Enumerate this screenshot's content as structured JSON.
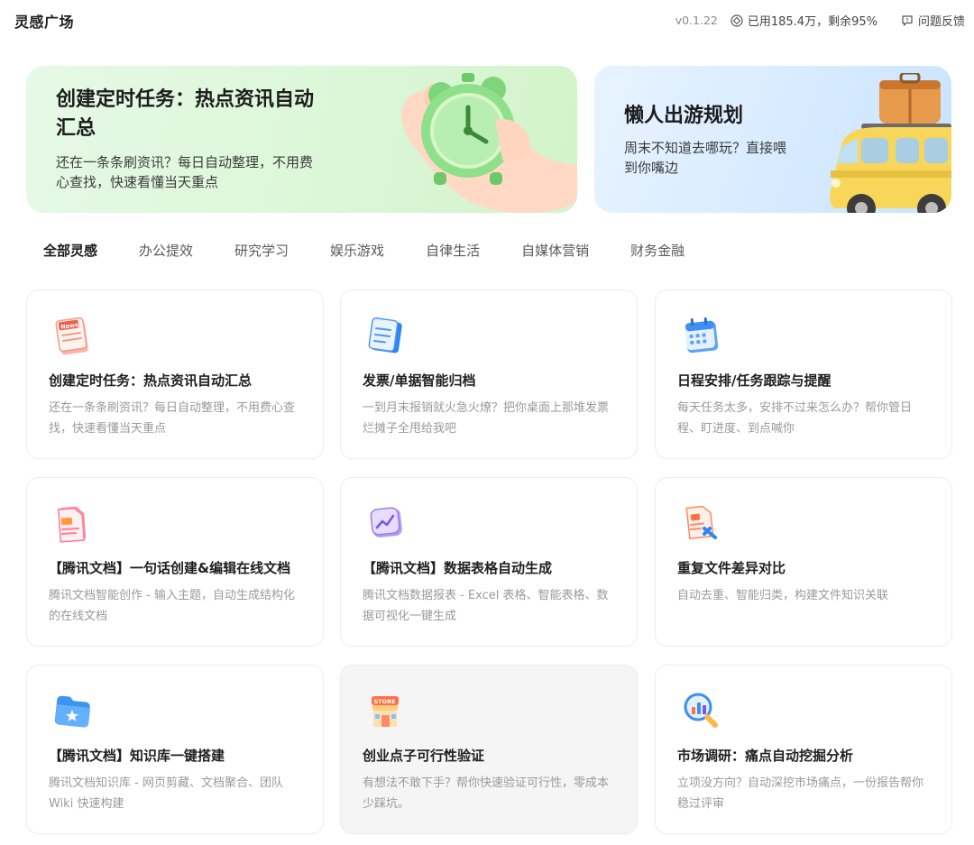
{
  "header": {
    "title": "灵感广场",
    "version": "v0.1.22",
    "quota": "已用185.4万，剩余95%",
    "feedback": "问题反馈"
  },
  "banners": [
    {
      "title": "创建定时任务：热点资讯自动汇总",
      "desc": "还在一条条刷资讯？每日自动整理，不用费心查找，快速看懂当天重点"
    },
    {
      "title": "懒人出游规划",
      "desc": "周末不知道去哪玩？直接喂到你嘴边"
    }
  ],
  "tabs": [
    "全部灵感",
    "办公提效",
    "研究学习",
    "娱乐游戏",
    "自律生活",
    "自媒体营销",
    "财务金融"
  ],
  "cards": [
    {
      "icon": "news-icon",
      "title": "创建定时任务：热点资讯自动汇总",
      "desc": "还在一条条刷资讯？每日自动整理，不用费心查找，快速看懂当天重点"
    },
    {
      "icon": "invoice-icon",
      "title": "发票/单据智能归档",
      "desc": "一到月末报销就火急火燎？把你桌面上那堆发票烂摊子全甩给我吧"
    },
    {
      "icon": "calendar-icon",
      "title": "日程安排/任务跟踪与提醒",
      "desc": "每天任务太多，安排不过来怎么办？帮你管日程、盯进度、到点喊你"
    },
    {
      "icon": "document-icon",
      "title": "【腾讯文档】一句话创建&编辑在线文档",
      "desc": "腾讯文档智能创作 - 输入主题，自动生成结构化的在线文档"
    },
    {
      "icon": "chart-window-icon",
      "title": "【腾讯文档】数据表格自动生成",
      "desc": "腾讯文档数据报表 - Excel 表格、智能表格、数据可视化一键生成"
    },
    {
      "icon": "compare-file-icon",
      "title": "重复文件差异对比",
      "desc": "自动去重、智能归类，构建文件知识关联"
    },
    {
      "icon": "folder-star-icon",
      "title": "【腾讯文档】知识库一键搭建",
      "desc": "腾讯文档知识库 - 网页剪藏、文档聚合、团队 Wiki 快速构建"
    },
    {
      "icon": "store-icon",
      "title": "创业点子可行性验证",
      "desc": "有想法不敢下手？帮你快速验证可行性，零成本少踩坑。"
    },
    {
      "icon": "magnifier-chart-icon",
      "title": "市场调研：痛点自动挖掘分析",
      "desc": "立项没方向？自动深挖市场痛点，一份报告帮你稳过评审"
    }
  ],
  "icon_labels": {
    "news": "News",
    "store": "STORE"
  },
  "colors": {
    "banner_green": "#dcf7d8",
    "banner_blue": "#d7ebff",
    "card_border": "#ededed",
    "desc_gray": "#9a9a9a"
  }
}
